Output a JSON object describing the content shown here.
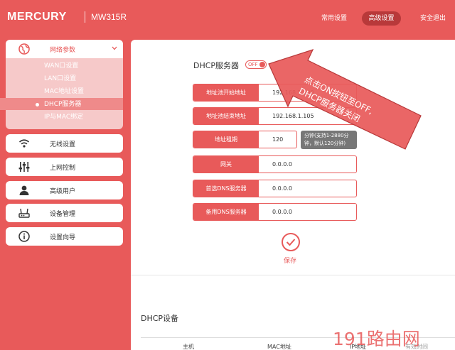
{
  "header": {
    "brand": "MERCURY",
    "model": "MW315R",
    "nav": [
      "常用设置",
      "高级设置",
      "安全退出"
    ]
  },
  "sidebar": {
    "network": {
      "label": "网络参数",
      "subitems": [
        "WAN口设置",
        "LAN口设置",
        "MAC地址设置",
        "DHCP服务器",
        "IP与MAC绑定"
      ]
    },
    "items": [
      {
        "label": "无线设置",
        "icon": "wifi-icon"
      },
      {
        "label": "上网控制",
        "icon": "sliders-icon"
      },
      {
        "label": "高级用户",
        "icon": "user-icon"
      },
      {
        "label": "设备管理",
        "icon": "router-icon"
      },
      {
        "label": "设置向导",
        "icon": "info-icon"
      }
    ]
  },
  "dhcp": {
    "title": "DHCP服务器",
    "toggle": "OFF",
    "fields": [
      {
        "label": "地址池开始地址",
        "value": "192.168.1.100"
      },
      {
        "label": "地址池结束地址",
        "value": "192.168.1.105"
      },
      {
        "label": "地址租期",
        "value": "120"
      },
      {
        "label": "网关",
        "value": "0.0.0.0"
      },
      {
        "label": "首选DNS服务器",
        "value": "0.0.0.0"
      },
      {
        "label": "备用DNS服务器",
        "value": "0.0.0.0"
      }
    ],
    "lease_tip_1": "分钟(支持1-2880分",
    "lease_tip_2": "钟，默认120分钟)",
    "save_label": "保存"
  },
  "annotation": {
    "line1": "点击ON按钮至OFF,",
    "line2": "DHCP服务器关闭"
  },
  "devices": {
    "title": "DHCP设备",
    "columns": [
      "主机",
      "MAC地址",
      "IP地址",
      "有效时间"
    ]
  },
  "watermark": "191路由网",
  "colors": {
    "accent": "#e85a5a",
    "active_nav": "#b8393a"
  }
}
